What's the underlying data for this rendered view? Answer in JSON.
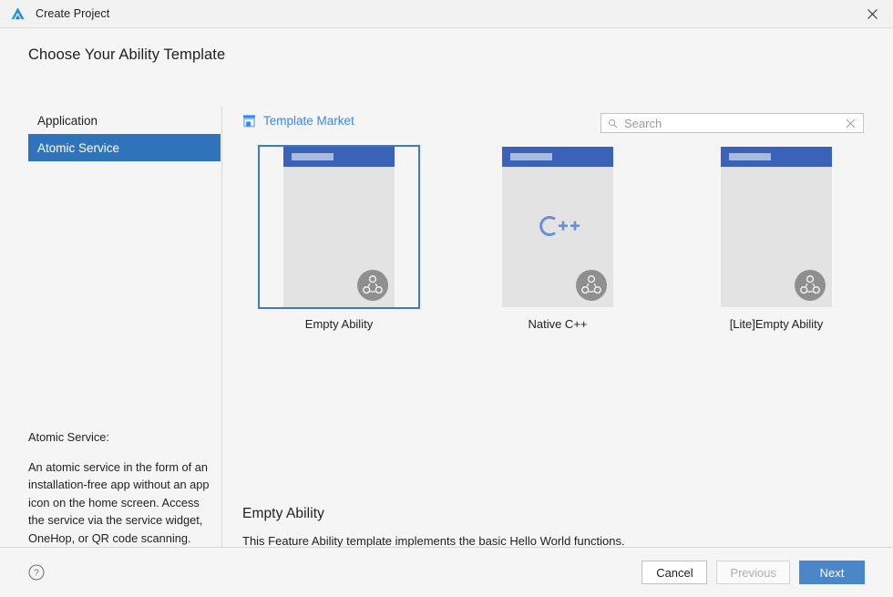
{
  "window": {
    "title": "Create Project",
    "logo_icon": "deveco-triangle-logo",
    "close_icon": "close-icon"
  },
  "heading": "Choose Your Ability Template",
  "sidebar": {
    "items": [
      {
        "label": "Application",
        "selected": false
      },
      {
        "label": "Atomic Service",
        "selected": true
      }
    ],
    "description": {
      "title": "Atomic Service:",
      "body": "An atomic service in the form of an installation-free app without an app icon on the home screen. Access the service via the service widget, OneHop, or QR code scanning."
    }
  },
  "toolbar": {
    "market_label": "Template Market",
    "market_icon": "store-icon",
    "search": {
      "placeholder": "Search",
      "value": "",
      "search_icon": "search-icon",
      "clear_icon": "clear-icon"
    }
  },
  "templates": [
    {
      "label": "Empty Ability",
      "selected": true,
      "center_glyph": "",
      "badge_icon": "atomic-service-badge-icon"
    },
    {
      "label": "Native C++",
      "selected": false,
      "center_glyph": "C++",
      "badge_icon": "atomic-service-badge-icon"
    },
    {
      "label": "[Lite]Empty Ability",
      "selected": false,
      "center_glyph": "",
      "badge_icon": "atomic-service-badge-icon"
    }
  ],
  "detail": {
    "title": "Empty Ability",
    "description": "This Feature Ability template implements the basic Hello World functions."
  },
  "footer": {
    "help_icon": "help-circle-icon",
    "cancel_label": "Cancel",
    "previous_label": "Previous",
    "next_label": "Next"
  },
  "colors": {
    "accent_blue": "#2f74bb",
    "link_blue": "#3c86e8",
    "primary_button": "#4a86c8",
    "phone_header": "#3a62b8",
    "selection_border": "#3b7cc4"
  }
}
